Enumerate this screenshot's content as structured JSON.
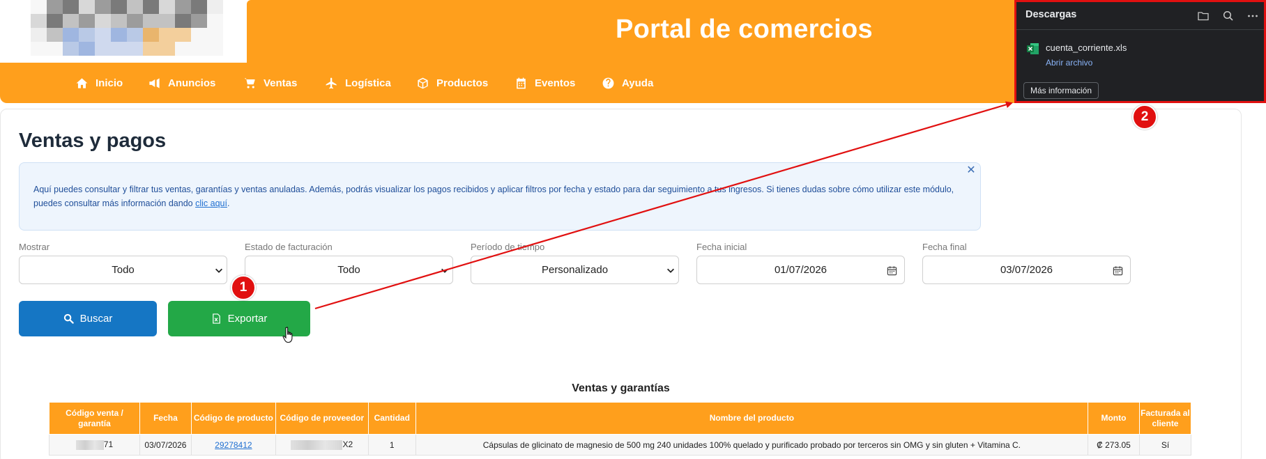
{
  "header": {
    "title": "Portal de comercios"
  },
  "nav": {
    "items": [
      {
        "label": "Inicio",
        "icon": "home-icon"
      },
      {
        "label": "Anuncios",
        "icon": "megaphone-icon"
      },
      {
        "label": "Ventas",
        "icon": "cart-icon"
      },
      {
        "label": "Logística",
        "icon": "plane-icon"
      },
      {
        "label": "Productos",
        "icon": "box-icon"
      },
      {
        "label": "Eventos",
        "icon": "calendar-icon"
      },
      {
        "label": "Ayuda",
        "icon": "help-icon"
      }
    ]
  },
  "page": {
    "title": "Ventas y pagos",
    "info_text": "Aquí puedes consultar y filtrar tus ventas, garantías y ventas anuladas. Además, podrás visualizar los pagos recibidos y aplicar filtros por fecha y estado para dar seguimiento a tus ingresos. Si tienes dudas sobre cómo utilizar este módulo, puedes consultar más información dando ",
    "info_link": "clic aquí",
    "info_tail": "."
  },
  "filters": {
    "mostrar": {
      "label": "Mostrar",
      "value": "Todo"
    },
    "estado": {
      "label": "Estado de facturación",
      "value": "Todo"
    },
    "periodo": {
      "label": "Período de tiempo",
      "value": "Personalizado"
    },
    "fecha_inicial": {
      "label": "Fecha inicial",
      "value": "01/07/2026"
    },
    "fecha_final": {
      "label": "Fecha final",
      "value": "03/07/2026"
    }
  },
  "buttons": {
    "search": "Buscar",
    "export": "Exportar"
  },
  "table": {
    "title": "Ventas y garantías",
    "headers": {
      "code": "Código venta / garantía",
      "date": "Fecha",
      "product_code": "Código de producto",
      "provider_code": "Código de proveedor",
      "qty": "Cantidad",
      "name": "Nombre del producto",
      "amount": "Monto",
      "billed": "Facturada al cliente"
    },
    "rows": [
      {
        "code_suffix": "71",
        "date": "03/07/2026",
        "product_code": "29278412",
        "provider_suffix": "X2",
        "qty": "1",
        "name": "Cápsulas de glicinato de magnesio de 500 mg 240 unidades 100% quelado y purificado probado por terceros sin OMG y sin gluten + Vitamina C.",
        "amount": "₡ 273.05",
        "billed": "Sí"
      }
    ]
  },
  "annotations": {
    "badge1": "1",
    "badge2": "2",
    "color": "#e11010"
  },
  "downloads": {
    "title": "Descargas",
    "file_name": "cuenta_corriente.xls",
    "open_label": "Abrir archivo",
    "more_label": "Más información"
  },
  "colors": {
    "brand_orange": "#ff9f1c",
    "search_blue": "#1576c4",
    "export_green": "#23a847"
  }
}
